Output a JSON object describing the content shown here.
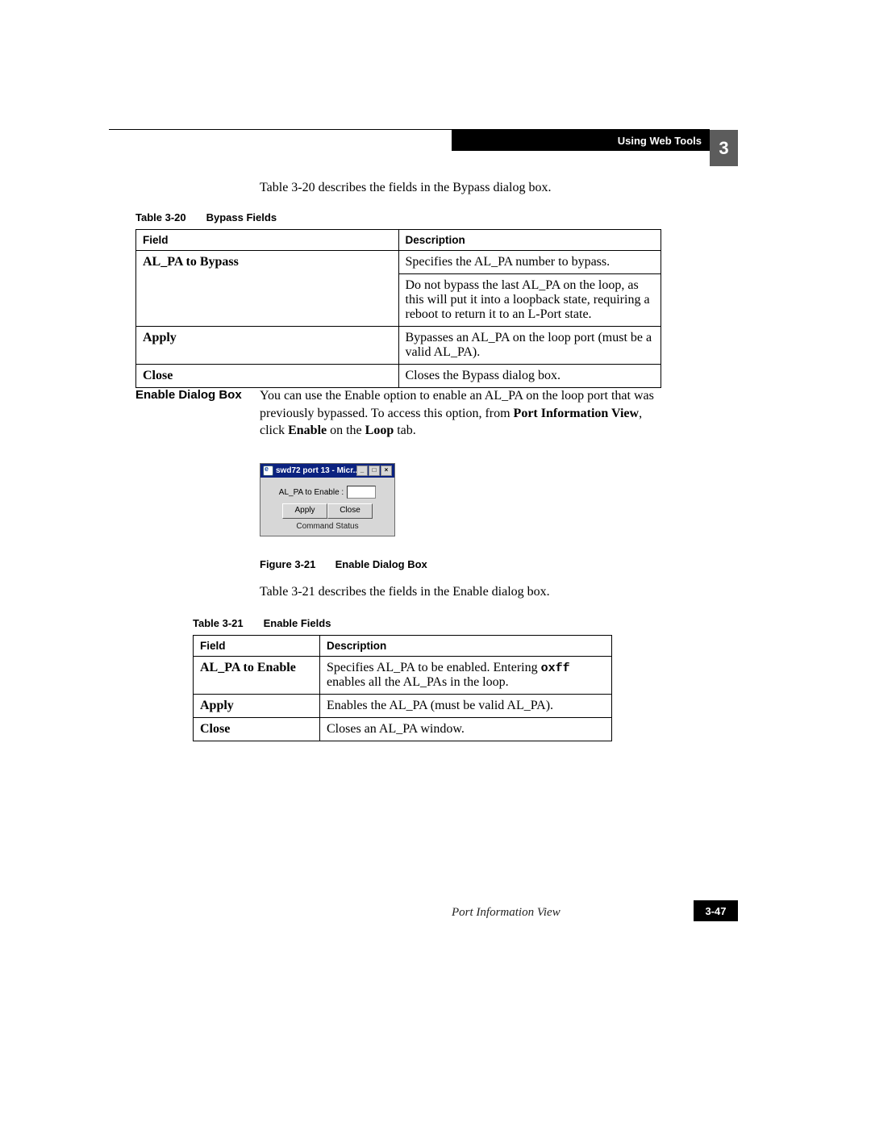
{
  "header": {
    "section": "Using Web Tools",
    "chapter": "3"
  },
  "intro1": "Table 3-20 describes the fields in the Bypass dialog box.",
  "table320": {
    "caption_num": "Table 3-20",
    "caption_title": "Bypass Fields",
    "head_field": "Field",
    "head_desc": "Description",
    "rows": [
      {
        "field": "AL_PA to Bypass",
        "desc1": "Specifies the AL_PA number to bypass.",
        "desc2": "Do not bypass the last AL_PA on the loop, as this will put it into a loopback state, requiring a reboot to return it to an L-Port state."
      },
      {
        "field": "Apply",
        "desc": "Bypasses an AL_PA on the loop port (must be a valid AL_PA)."
      },
      {
        "field": "Close",
        "desc": "Closes the Bypass dialog box."
      }
    ]
  },
  "enable_section": {
    "label": "Enable Dialog Box",
    "para_pre": "You can use the Enable option to enable an AL_PA on the loop port that was previously bypassed. To access this option, from ",
    "para_b1": "Port Information View",
    "para_mid": ", click ",
    "para_b2": "Enable",
    "para_mid2": " on the ",
    "para_b3": "Loop",
    "para_end": " tab."
  },
  "dialog": {
    "title": "swd72 port 13 - Micr...",
    "label": "AL_PA to Enable :",
    "btn_apply": "Apply",
    "btn_close": "Close",
    "status": "Command Status"
  },
  "figure": {
    "num": "Figure 3-21",
    "title": "Enable Dialog Box"
  },
  "intro2": "Table 3-21 describes the fields in the Enable dialog box.",
  "table321": {
    "caption_num": "Table 3-21",
    "caption_title": "Enable Fields",
    "head_field": "Field",
    "head_desc": "Description",
    "rows": [
      {
        "field": "AL_PA to Enable",
        "desc_pre": "Specifies AL_PA to be enabled. Entering ",
        "desc_code": "oxff",
        "desc_post": " enables all the AL_PAs in the loop."
      },
      {
        "field": "Apply",
        "desc": "Enables the AL_PA (must be valid AL_PA)."
      },
      {
        "field": "Close",
        "desc": "Closes an AL_PA window."
      }
    ]
  },
  "footer": {
    "section": "Port Information View",
    "page": "3-47"
  }
}
